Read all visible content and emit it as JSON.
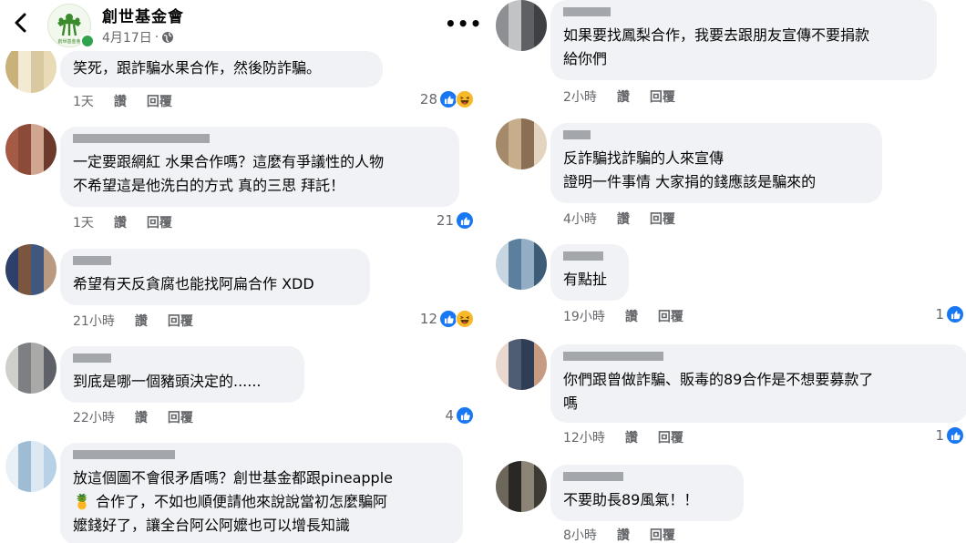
{
  "post": {
    "page_name": "創世基金會",
    "date": "4月17日",
    "separator": "·",
    "avatar_logo_text": "創世基金會"
  },
  "actions": {
    "like": "讚",
    "reply": "回覆"
  },
  "left_comments": [
    {
      "text": "笑死，跟詐騙水果合作，然後防詐騙。",
      "time": "1天",
      "count": "28",
      "reactions": [
        "like",
        "haha"
      ]
    },
    {
      "text": "一定要跟網紅 水果合作嗎？這麼有爭議性的人物\n不希望這是他洗白的方式 真的三思 拜託！",
      "time": "1天",
      "count": "21",
      "reactions": [
        "like"
      ]
    },
    {
      "text": "希望有天反貪腐也能找阿扁合作 XDD",
      "time": "21小時",
      "count": "12",
      "reactions": [
        "like",
        "haha"
      ]
    },
    {
      "text": "到底是哪一個豬頭決定的......",
      "time": "22小時",
      "count": "4",
      "reactions": [
        "like"
      ]
    },
    {
      "text": "放這個圖不會很矛盾嗎？創世基金都跟pineapple\n🍍 合作了，不如也順便請他來說說當初怎麼騙阿\n嬤錢好了，讓全台阿公阿嬤也可以增長知識",
      "time": "",
      "count": "",
      "reactions": []
    }
  ],
  "right_comments": [
    {
      "text": "如果要找鳳梨合作，我要去跟朋友宣傳不要捐款\n給你們",
      "time": "2小時",
      "count": "",
      "reactions": []
    },
    {
      "text": "反詐騙找詐騙的人來宣傳\n證明一件事情 大家捐的錢應該是騙來的",
      "time": "4小時",
      "count": "",
      "reactions": []
    },
    {
      "text": "有點扯",
      "time": "19小時",
      "count": "1",
      "reactions": [
        "like"
      ]
    },
    {
      "text": "你們跟曾做詐騙、販毒的89合作是不想要募款了\n嗎",
      "time": "12小時",
      "count": "1",
      "reactions": [
        "like"
      ]
    },
    {
      "text": "不要助長89風氣！！",
      "time": "8小時",
      "count": "",
      "reactions": []
    }
  ],
  "icons": {
    "back": "back-arrow-icon",
    "more": "more-options-icon",
    "globe": "globe-icon",
    "like": "like-reaction-icon",
    "haha": "haha-reaction-icon"
  },
  "colors": {
    "like_blue": "#1877f2",
    "haha_yellow": "#f7b928",
    "bubble_bg": "#f0f2f5",
    "meta_gray": "#65676b",
    "online_green": "#31a24c",
    "logo_green": "#3a8a2c"
  }
}
